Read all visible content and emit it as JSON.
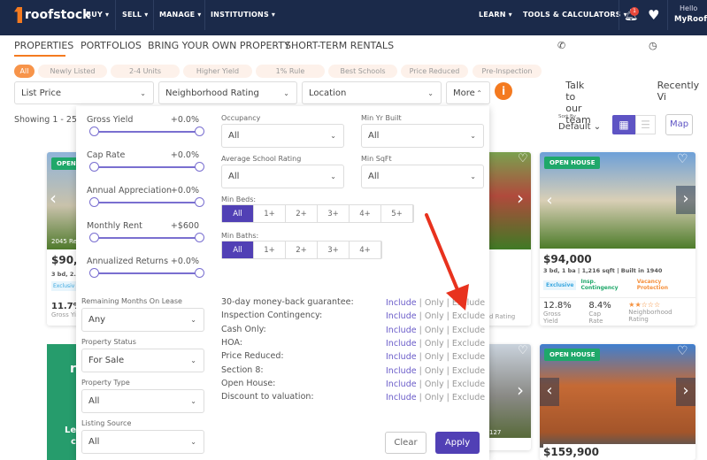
{
  "nav": {
    "brand": "roofstock",
    "items": [
      "BUY",
      "SELL",
      "MANAGE",
      "INSTITUTIONS"
    ],
    "right_items": [
      "LEARN",
      "TOOLS & CALCULATORS"
    ],
    "notification_count": "1",
    "greeting": "Hello",
    "user": "MyRoofs"
  },
  "subnav": {
    "tabs": [
      "PROPERTIES",
      "PORTFOLIOS",
      "BRING YOUR OWN PROPERTY",
      "SHORT-TERM RENTALS"
    ],
    "talk": "Talk to our team",
    "recent": "Recently Vi"
  },
  "chips": [
    "All",
    "Newly Listed",
    "2-4 Units",
    "Higher Yield",
    "1% Rule",
    "Best Schools",
    "Price Reduced",
    "Pre-Inspection"
  ],
  "filters": {
    "list_price": "List Price",
    "neighborhood": "Neighborhood Rating",
    "location": "Location",
    "more": "More"
  },
  "results": {
    "showing": "Showing 1 - 25 o",
    "sort_label": "Sort By",
    "sort_value": "Default",
    "map": "Map"
  },
  "panel": {
    "sliders": [
      {
        "label": "Gross Yield",
        "value": "0.0%+"
      },
      {
        "label": "Cap Rate",
        "value": "0.0%+"
      },
      {
        "label": "Annual Appreciation",
        "value": "0.0%+"
      },
      {
        "label": "Monthly Rent",
        "value": "$600+"
      },
      {
        "label": "Annualized Returns",
        "value": "0.0%+"
      }
    ],
    "left_selects": [
      {
        "label": "Remaining Months On Lease",
        "value": "Any"
      },
      {
        "label": "Property Status",
        "value": "For Sale"
      },
      {
        "label": "Property Type",
        "value": "All"
      },
      {
        "label": "Listing Source",
        "value": "All"
      }
    ],
    "occupancy": {
      "label": "Occupancy",
      "value": "All"
    },
    "min_yr": {
      "label": "Min Yr Built",
      "value": "All"
    },
    "school": {
      "label": "Average School Rating",
      "value": "All"
    },
    "sqft": {
      "label": "Min SqFt",
      "value": "All"
    },
    "beds": {
      "label": "Min Beds:",
      "options": [
        "All",
        "1+",
        "2+",
        "3+",
        "4+",
        "5+"
      ],
      "selected": "All"
    },
    "baths": {
      "label": "Min Baths:",
      "options": [
        "All",
        "1+",
        "2+",
        "3+",
        "4+"
      ],
      "selected": "All"
    },
    "toggles": [
      "30-day money-back guarantee:",
      "Inspection Contingency:",
      "Cash Only:",
      "HOA:",
      "Price Reduced:",
      "Section 8:",
      "Open House:",
      "Discount to valuation:"
    ],
    "toggle_options": {
      "include": "Include",
      "only": "Only",
      "exclude": "Exclude",
      "sep": "|"
    },
    "clear": "Clear",
    "apply": "Apply"
  },
  "cards": {
    "left": {
      "badge": "OPEN",
      "address": "2045 Re",
      "price": "$90,0",
      "specs": "3 bd, 2.5",
      "tag": "Exclusiv",
      "yield": "11.7%",
      "yield_label": "Gross Yi"
    },
    "mid": {
      "rating_label": "hood Rating",
      "addr": "127"
    },
    "right": {
      "badge": "OPEN HOUSE",
      "price": "$94,000",
      "beds": "3 bd, 1 ba",
      "sqft": "1,216 sqft",
      "built": "Built in 1940",
      "tags": [
        "Exclusive",
        "Insp. Contingency",
        "Vacancy Protection"
      ],
      "gross_yield": "12.8%",
      "gross_label": "Gross Yield",
      "cap_rate": "8.4%",
      "cap_label": "Cap Rate",
      "rating": "★★☆☆☆",
      "rating_label": "Neighborhood Rating"
    },
    "right2": {
      "badge": "OPEN HOUSE",
      "price": "$159,900"
    },
    "promo": {
      "t1": "r",
      "t2": "Le",
      "t3": "c"
    }
  },
  "colors": {
    "nav": "#1b2a4a",
    "accent": "#f47a20",
    "purple": "#5140b5",
    "green": "#1fa86a",
    "arrow": "#e8321e"
  }
}
